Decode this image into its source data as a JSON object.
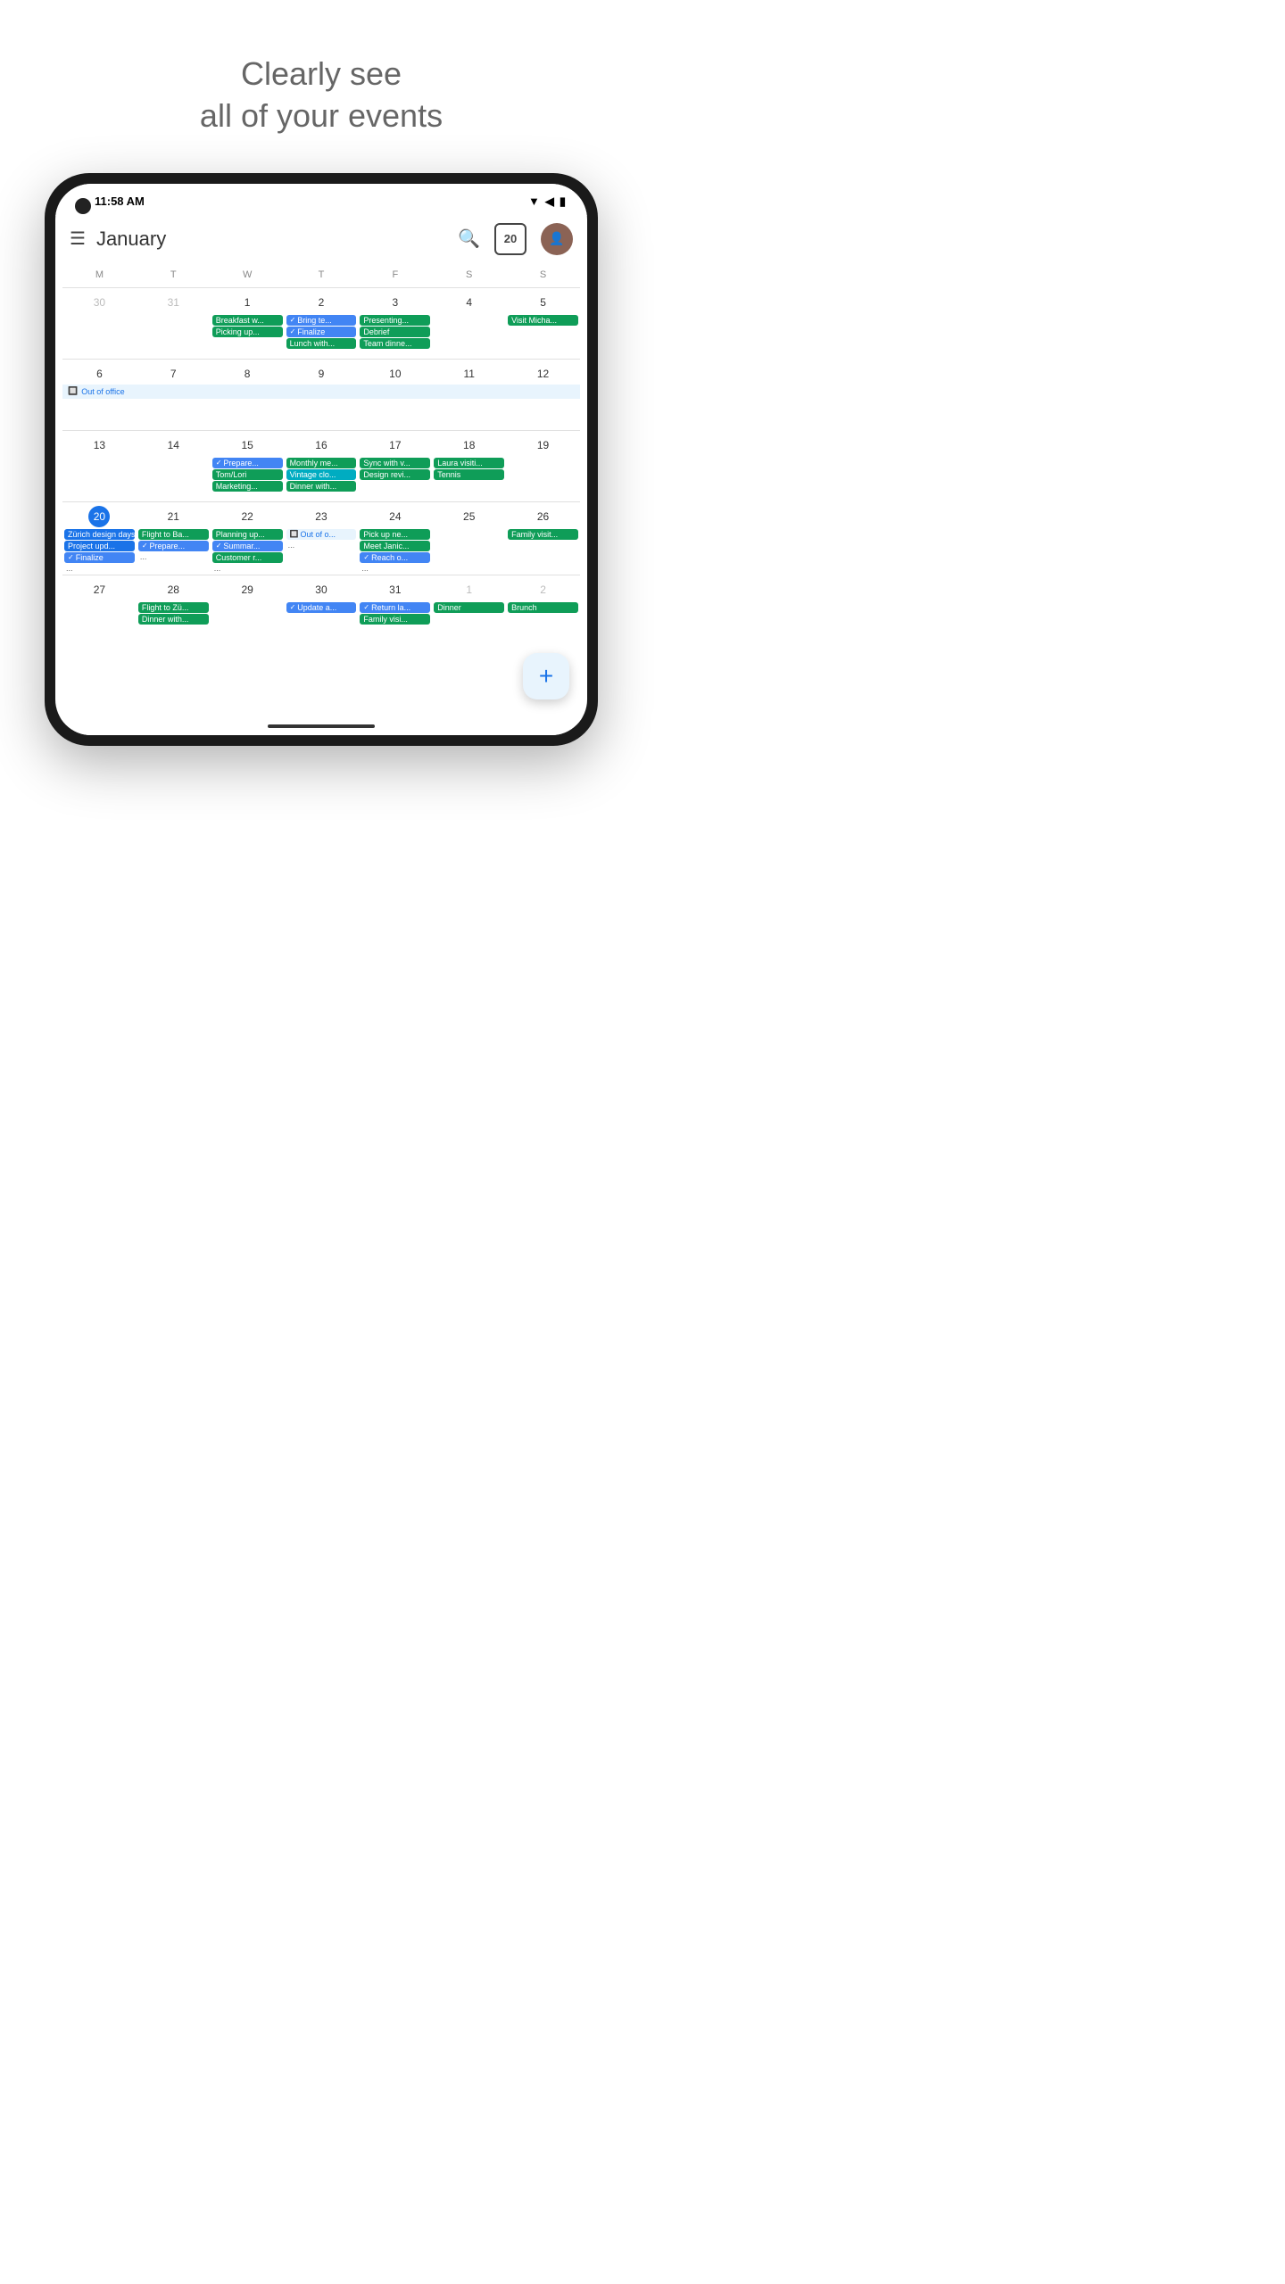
{
  "hero": {
    "line1": "Clearly see",
    "line2": "all of your events"
  },
  "statusBar": {
    "time": "11:58 AM",
    "icons": "▼◀🔋"
  },
  "header": {
    "month": "January",
    "todayNumber": "20",
    "searchLabel": "Search",
    "menuLabel": "Menu"
  },
  "dayHeaders": [
    "M",
    "T",
    "W",
    "T",
    "F",
    "S",
    "S"
  ],
  "weeks": [
    {
      "days": [
        {
          "num": "30",
          "otherMonth": true,
          "events": []
        },
        {
          "num": "31",
          "otherMonth": true,
          "events": []
        },
        {
          "num": "1",
          "events": [
            {
              "text": "Breakfast w...",
              "type": "green"
            },
            {
              "text": "Picking up...",
              "type": "green"
            }
          ]
        },
        {
          "num": "2",
          "events": [
            {
              "text": "Bring te...",
              "type": "check-blue",
              "hasCheck": true
            },
            {
              "text": "Finalize",
              "type": "check-blue",
              "hasCheck": true
            },
            {
              "text": "Lunch with...",
              "type": "green"
            }
          ]
        },
        {
          "num": "3",
          "events": [
            {
              "text": "Presenting...",
              "type": "green"
            },
            {
              "text": "Debrief",
              "type": "green"
            },
            {
              "text": "Team dinne...",
              "type": "green"
            }
          ]
        },
        {
          "num": "4",
          "events": []
        },
        {
          "num": "5",
          "events": [
            {
              "text": "Visit Micha...",
              "type": "green"
            }
          ]
        }
      ]
    },
    {
      "outOfOffice": true,
      "outOfOfficeText": "Out of office",
      "days": [
        {
          "num": "6",
          "events": []
        },
        {
          "num": "7",
          "events": []
        },
        {
          "num": "8",
          "events": []
        },
        {
          "num": "9",
          "events": []
        },
        {
          "num": "10",
          "events": []
        },
        {
          "num": "11",
          "events": []
        },
        {
          "num": "12",
          "events": []
        }
      ]
    },
    {
      "days": [
        {
          "num": "13",
          "events": []
        },
        {
          "num": "14",
          "events": []
        },
        {
          "num": "15",
          "events": [
            {
              "text": "Prepare...",
              "type": "check-blue",
              "hasCheck": true
            },
            {
              "text": "Tom/Lori",
              "type": "green"
            },
            {
              "text": "Marketing...",
              "type": "green"
            }
          ]
        },
        {
          "num": "16",
          "events": [
            {
              "text": "Monthly me...",
              "type": "green"
            },
            {
              "text": "Vintage clo...",
              "type": "teal"
            },
            {
              "text": "Dinner with...",
              "type": "green"
            }
          ]
        },
        {
          "num": "17",
          "events": [
            {
              "text": "Sync with v...",
              "type": "green"
            },
            {
              "text": "Design revi...",
              "type": "green"
            }
          ]
        },
        {
          "num": "18",
          "events": [
            {
              "text": "Laura visiti...",
              "type": "green"
            },
            {
              "text": "Tennis",
              "type": "green"
            }
          ]
        },
        {
          "num": "19",
          "events": []
        }
      ]
    },
    {
      "days": [
        {
          "num": "20",
          "today": true,
          "events": [
            {
              "text": "Zürich design days",
              "type": "blue"
            },
            {
              "text": "Project upd...",
              "type": "blue"
            },
            {
              "text": "Finalize",
              "type": "check-blue",
              "hasCheck": true
            }
          ],
          "more": "..."
        },
        {
          "num": "21",
          "events": [
            {
              "text": "Flight to Ba...",
              "type": "green"
            },
            {
              "text": "Prepare...",
              "type": "check-blue",
              "hasCheck": true
            }
          ],
          "more": "..."
        },
        {
          "num": "22",
          "events": [
            {
              "text": "Planning up...",
              "type": "green"
            },
            {
              "text": "Summar...",
              "type": "check-blue",
              "hasCheck": true
            },
            {
              "text": "Customer r...",
              "type": "green"
            }
          ],
          "more": "..."
        },
        {
          "num": "23",
          "events": [
            {
              "text": "Out of o...",
              "type": "light-blue"
            }
          ],
          "more": "..."
        },
        {
          "num": "24",
          "events": [
            {
              "text": "Pick up ne...",
              "type": "green"
            },
            {
              "text": "Meet Janic...",
              "type": "green"
            },
            {
              "text": "Reach o...",
              "type": "check-blue",
              "hasCheck": true
            }
          ],
          "more": "..."
        },
        {
          "num": "25",
          "events": []
        },
        {
          "num": "26",
          "events": [
            {
              "text": "Family visit...",
              "type": "green"
            }
          ]
        }
      ]
    },
    {
      "days": [
        {
          "num": "27",
          "events": []
        },
        {
          "num": "28",
          "events": [
            {
              "text": "Flight to Zü...",
              "type": "green"
            },
            {
              "text": "Dinner with...",
              "type": "green"
            }
          ]
        },
        {
          "num": "29",
          "events": []
        },
        {
          "num": "30",
          "events": [
            {
              "text": "Update a...",
              "type": "check-blue",
              "hasCheck": true
            }
          ]
        },
        {
          "num": "31",
          "events": [
            {
              "text": "Return la...",
              "type": "check-blue",
              "hasCheck": true
            },
            {
              "text": "Family visi...",
              "type": "green"
            }
          ]
        },
        {
          "num": "1",
          "otherMonth": true,
          "events": [
            {
              "text": "Dinner",
              "type": "green"
            }
          ]
        },
        {
          "num": "2",
          "otherMonth": true,
          "events": [
            {
              "text": "Brunch",
              "type": "green"
            }
          ]
        }
      ]
    }
  ],
  "fab": {
    "label": "+",
    "ariaLabel": "Add event"
  }
}
